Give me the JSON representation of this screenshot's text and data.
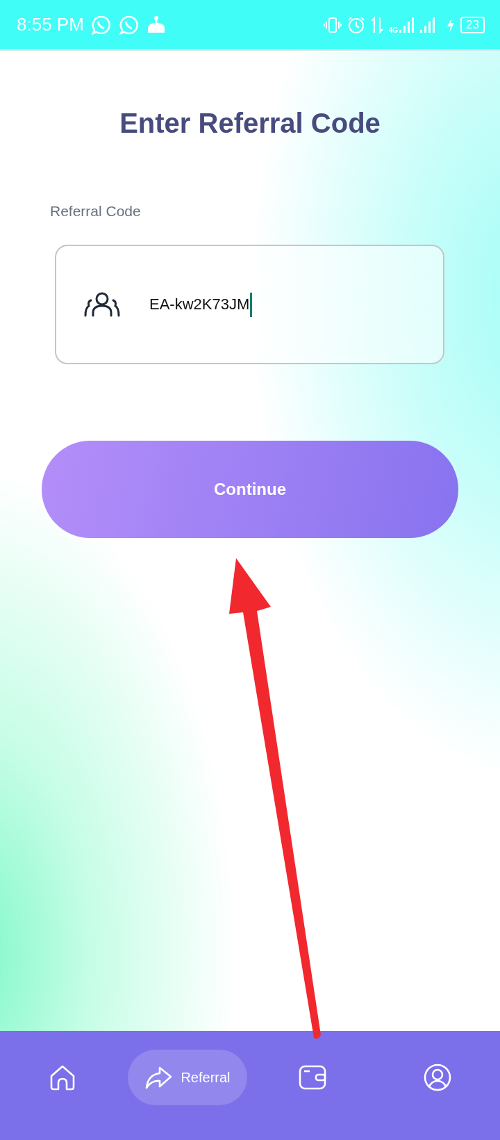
{
  "status_bar": {
    "time": "8:55 PM",
    "network": "4G",
    "battery": "23"
  },
  "title": "Enter Referral Code",
  "referral_field": {
    "label": "Referral Code",
    "value": "EA-kw2K73JM"
  },
  "continue_button": "Continue",
  "bottom_nav": [
    {
      "selected": false
    },
    {
      "label": "Referral",
      "selected": true
    },
    {
      "selected": false
    },
    {
      "selected": false
    }
  ]
}
